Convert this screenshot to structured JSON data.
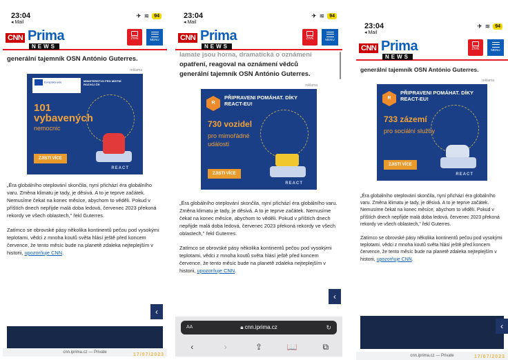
{
  "status_bar": {
    "time": "23:04",
    "back_label": "◂ Mail",
    "battery": "94"
  },
  "header": {
    "cnn": "CNN",
    "brand": "Prima",
    "news": "NEWS",
    "live_label": "ŽIVĚ",
    "menu_label": "MENU"
  },
  "article": {
    "headline_tail": "generální tajemník OSN António Guterres.",
    "headline_clipped": "lamate jsou horna, dramatická o oznámení",
    "headline_middle": "opatření, reagoval na oznámení vědců",
    "ad_label": "reklama",
    "paragraph_1": "„Éra globálního oteplování skončila, nyní přichází éra globálního varu. Změna klimatu je tady, je děsivá. A to je teprve začátek. Nemusíme čekat na konec měsíce, abychom to věděli. Pokud v příštích dnech nepřijde malá doba ledová, červenec 2023 překoná rekordy ve všech oblastech,\" řekl Guterres.",
    "paragraph_2_text": "Zatímco se obrovské pásy několika kontinentů pečou pod vysokými teplotami, vědci z mnoha koutů světa hlásí ještě před koncem července, že tento měsíc bude na planetě zdaleka nejteplejším v historii, ",
    "paragraph_2_link": "upozorňuje CNN",
    "paragraph_2_end": "."
  },
  "ads": {
    "ad1": {
      "eu_text": "Evropská unie",
      "ministry": "MINISTERSTVO PRO MÍSTNÍ ROZVOJ ČR",
      "big": "101",
      "big2": "vybavených",
      "sub": "nemocnic",
      "cta": "ZJISTI VÍCE",
      "react": "REACT"
    },
    "ad2": {
      "hex": "R",
      "title": "PŘIPRAVENI POMÁHAT. DÍKY REACT-EU!",
      "big": "730 vozidel",
      "sub": "pro mimořádné události",
      "cta": "ZJISTI VÍCE",
      "react": "REACT"
    },
    "ad3": {
      "hex": "R",
      "title": "PŘIPRAVENI POMÁHAT. DÍKY REACT-EU!",
      "big": "733 zázemí",
      "sub": "pro sociální služby",
      "cta": "ZJISTI VÍCE",
      "react": "REACT"
    }
  },
  "browser": {
    "url": "cnn.iprima.cz",
    "aa": "AA",
    "footer_url": "cnn.iprima.cz — Private",
    "date_stamp": "17/07/2023"
  },
  "icons": {
    "chevron": "‹",
    "back": "‹",
    "forward": "›",
    "share": "⇪",
    "bookmarks": "📖",
    "tabs": "⧉",
    "reload": "↻"
  }
}
